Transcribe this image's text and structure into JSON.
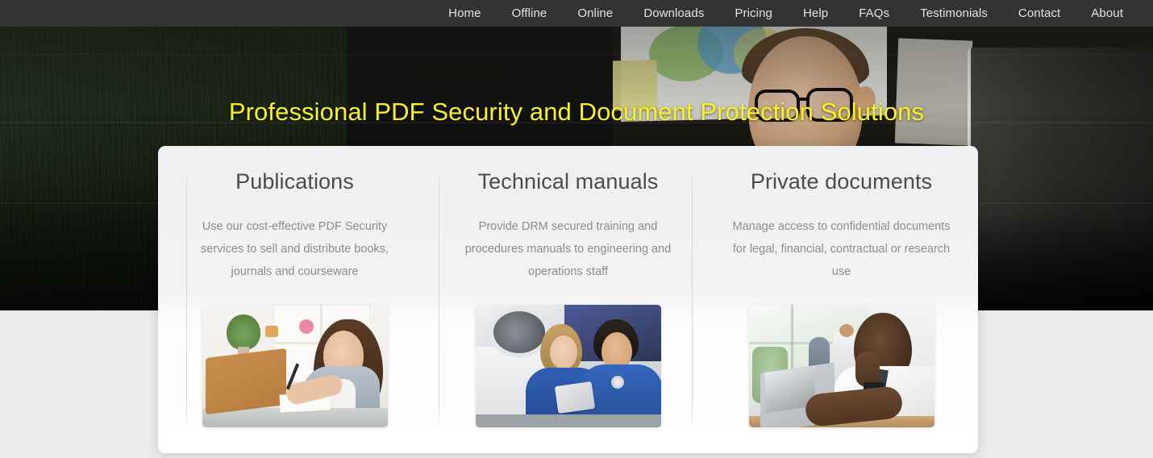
{
  "nav": {
    "items": [
      {
        "label": "Home",
        "name": "nav-item-home"
      },
      {
        "label": "Offline",
        "name": "nav-item-offline"
      },
      {
        "label": "Online",
        "name": "nav-item-online"
      },
      {
        "label": "Downloads",
        "name": "nav-item-downloads"
      },
      {
        "label": "Pricing",
        "name": "nav-item-pricing"
      },
      {
        "label": "Help",
        "name": "nav-item-help"
      },
      {
        "label": "FAQs",
        "name": "nav-item-faqs"
      },
      {
        "label": "Testimonials",
        "name": "nav-item-testimonials"
      },
      {
        "label": "Contact",
        "name": "nav-item-contact"
      },
      {
        "label": "About",
        "name": "nav-item-about"
      }
    ],
    "background_color": "#333333",
    "text_color": "#e6e2e2"
  },
  "hero": {
    "headline": "Professional PDF Security and Document Protection Solutions",
    "headline_color": "#fbf31a",
    "image_description": "man with glasses working at a desk in a dark office"
  },
  "cards": [
    {
      "title": "Publications",
      "description": "Use our cost-effective PDF Security services to sell and distribute books, journals and courseware",
      "image_description": "woman writing notes beside a laptop in a bright room"
    },
    {
      "title": "Technical manuals",
      "description": "Provide DRM secured training and procedures manuals to engineering and operations staff",
      "image_description": "two engineers in blue shirts reviewing a tablet beside an aircraft"
    },
    {
      "title": "Private documents",
      "description": "Manage access to confidential documents for legal, financial, contractual or research use",
      "image_description": "businessman in white shirt typing on a laptop in an open office"
    }
  ],
  "theme": {
    "page_background": "#ebebeb",
    "panel_background": "#ffffff",
    "title_color": "#4b4b4b",
    "body_text_color": "#8d8d8d"
  }
}
